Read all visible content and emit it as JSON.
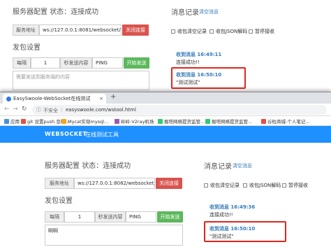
{
  "top": {
    "server_config_title": "服务器配置",
    "status_label": "状态：",
    "status_value": "连接成功",
    "server_addr_label": "服务地址",
    "server_addr_value": "ws://127.0.0.1:8081/websocket/4!",
    "close_conn_button": "关闭连接",
    "send_title": "发包设置",
    "every_label": "每隔",
    "interval_value": "1",
    "send_content_label": "秒发送内容",
    "send_content_value": "PING",
    "start_send_button": "开始发送",
    "message_placeholder": "需要发送到服务端的内容",
    "log_title": "消息记录",
    "clear_messages_link": "清空消息",
    "opt_clear_before_send": "收包清空记录",
    "opt_recv_json_decode": "收包JSON解码",
    "opt_pause_recv": "暂停接收",
    "messages": [
      {
        "title": "收到消息  16:49:11",
        "body": "连接成功!!"
      },
      {
        "title": "收到消息  16:50:10",
        "body": "\"测试测试\""
      }
    ]
  },
  "browser": {
    "tab_title": "EasySwoole-WebSocket在线测试",
    "close_tab": "×",
    "new_tab": "+",
    "insecure_label": "不安全",
    "separator": "|",
    "url": "easyswoole.com/wstool.html",
    "bookmarks": [
      "应用",
      "git 设置push 忽略...",
      "Mycat实现mysql...",
      "岭岭-V2ray机场",
      "掘塔网络提货监管...",
      "掘塔网络提货监管...",
      "谷粒商城-个人笔记..."
    ],
    "app_title": "WEBSOCKET",
    "app_subtitle": "在线测试工具"
  },
  "bottom": {
    "server_config_title": "服务器配置",
    "status_label": "状态：",
    "status_value": "连接成功",
    "server_addr_label": "服务地址",
    "server_addr_value": "ws://127.0.0.1:8082/websocket/4",
    "close_conn_button": "关闭连接",
    "send_title": "发包设置",
    "every_label": "每隔",
    "interval_value": "1",
    "send_content_label": "秒发送内容",
    "send_content_value": "PING",
    "start_send_button": "开始发送",
    "message_value": "啊啊",
    "log_title": "消息记录",
    "clear_messages_link": "清空消息",
    "opt_clear_before_send": "收包清空记录",
    "opt_recv_json_decode": "收包JSON解码",
    "opt_pause_recv": "暂停接收",
    "messages": [
      {
        "title": "收到消息  16:49:36",
        "body": "连接成功!!"
      },
      {
        "title": "收到消息  16:50:10",
        "body": "\"测试测试\""
      }
    ]
  },
  "colors": {
    "red_button": "#d9534f",
    "green_button": "#5cb85c",
    "app_bar": "#1e90ff",
    "link": "#337ab7",
    "highlight": "#e0261c"
  }
}
